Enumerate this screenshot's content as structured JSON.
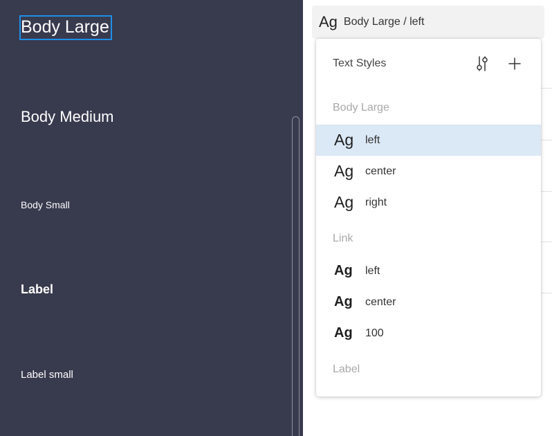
{
  "canvas": {
    "texts": {
      "body_large": "Body Large",
      "body_medium": "Body Medium",
      "body_small": "Body Small",
      "label": "Label",
      "label_small": "Label small"
    }
  },
  "style_select": {
    "sample": "Ag",
    "current_style": "Body Large / left"
  },
  "text_styles_popup": {
    "title": "Text Styles",
    "groups": [
      {
        "name": "Body Large",
        "items": [
          {
            "sample": "Ag",
            "label": "left",
            "selected": true
          },
          {
            "sample": "Ag",
            "label": "center"
          },
          {
            "sample": "Ag",
            "label": "right"
          }
        ]
      },
      {
        "name": "Link",
        "items": [
          {
            "sample": "Ag",
            "label": "left"
          },
          {
            "sample": "Ag",
            "label": "center"
          },
          {
            "sample": "Ag",
            "label": "100"
          }
        ]
      },
      {
        "name": "Label",
        "items": []
      }
    ]
  },
  "colors": {
    "canvas_bg": "#383a4e",
    "selection": "#1e8fe8",
    "selected_row": "#dbe8f5"
  },
  "icons": [
    "settings-sliders-icon",
    "plus-icon"
  ]
}
